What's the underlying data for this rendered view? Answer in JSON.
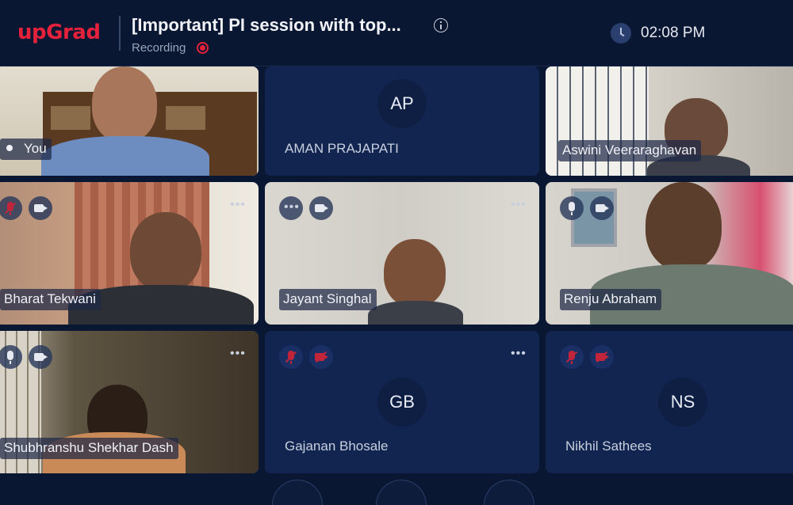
{
  "header": {
    "logo": "upGrad",
    "title": "[Important] PI session with top...",
    "recording_label": "Recording",
    "time": "02:08 PM"
  },
  "participants": [
    {
      "name": "You",
      "initials": "",
      "video": true
    },
    {
      "name": "AMAN PRAJAPATI",
      "initials": "AP",
      "video": false
    },
    {
      "name": "Aswini Veeraraghavan",
      "initials": "",
      "video": true
    },
    {
      "name": "Bharat Tekwani",
      "initials": "",
      "video": true
    },
    {
      "name": "Jayant Singhal",
      "initials": "",
      "video": true
    },
    {
      "name": "Renju Abraham",
      "initials": "",
      "video": true
    },
    {
      "name": "Shubhranshu Shekhar Dash",
      "initials": "",
      "video": true
    },
    {
      "name": "Gajanan Bhosale",
      "initials": "GB",
      "video": false
    },
    {
      "name": "Nikhil Sathees",
      "initials": "NS",
      "video": false
    }
  ],
  "colors": {
    "background": "#0a1733",
    "tile": "#122551",
    "brand": "#e5213b",
    "muted": "#c2253a"
  }
}
